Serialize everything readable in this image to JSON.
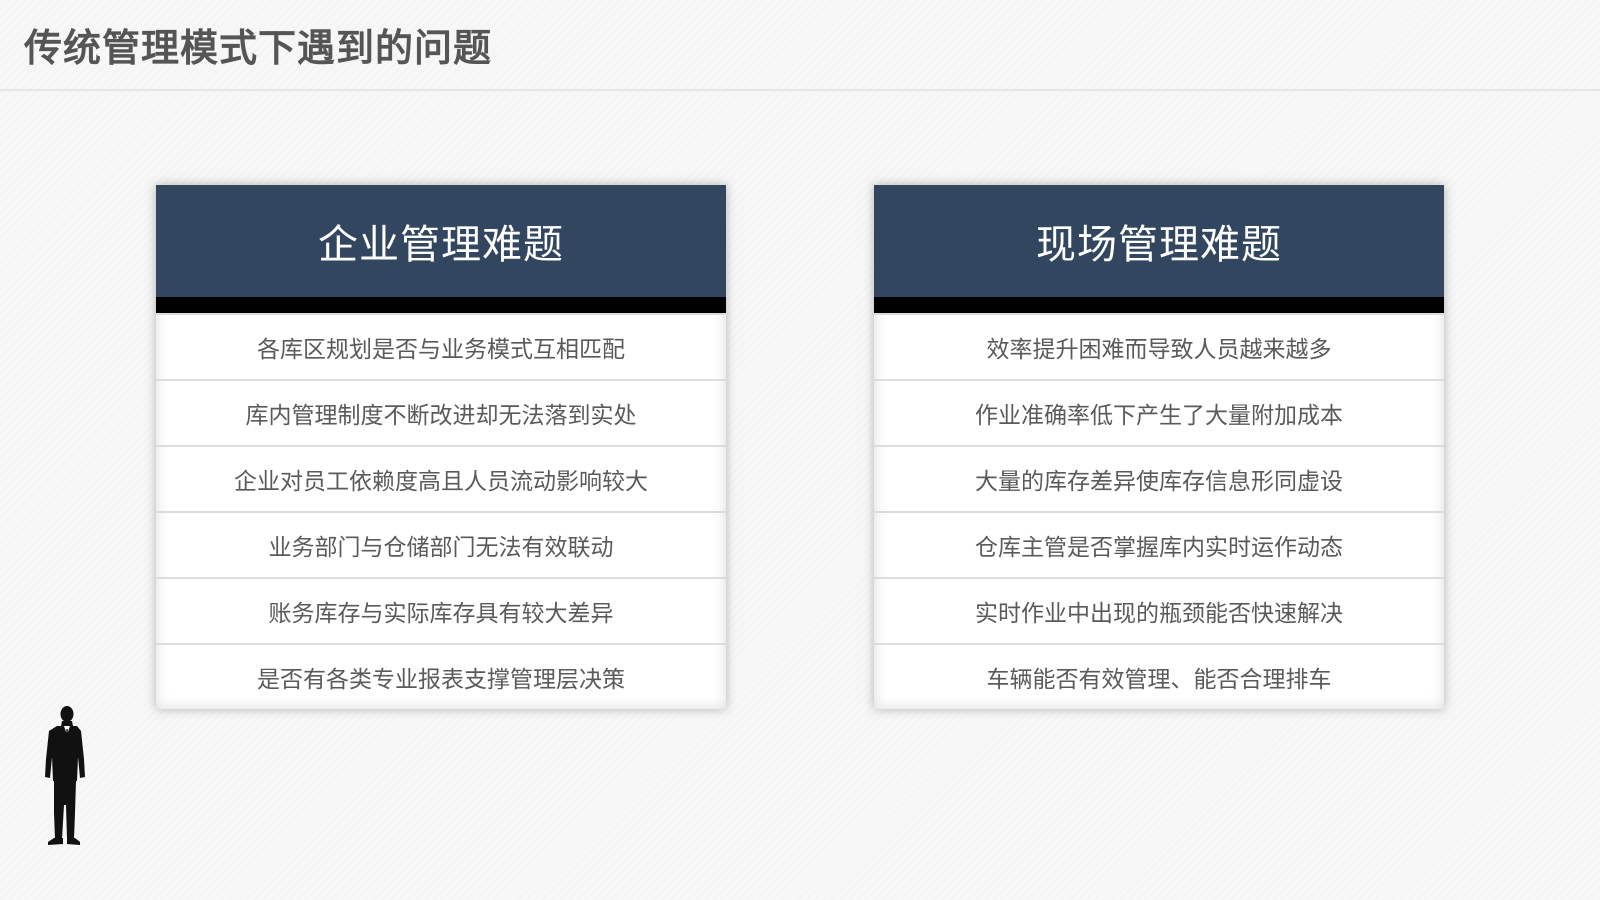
{
  "slide": {
    "title": "传统管理模式下遇到的问题"
  },
  "panels": [
    {
      "heading": "企业管理难题",
      "items": [
        "各库区规划是否与业务模式互相匹配",
        "库内管理制度不断改进却无法落到实处",
        "企业对员工依赖度高且人员流动影响较大",
        "业务部门与仓储部门无法有效联动",
        "账务库存与实际库存具有较大差异",
        "是否有各类专业报表支撑管理层决策"
      ]
    },
    {
      "heading": "现场管理难题",
      "items": [
        "效率提升困难而导致人员越来越多",
        "作业准确率低下产生了大量附加成本",
        "大量的库存差异使库存信息形同虚设",
        "仓库主管是否掌握库内实时运作动态",
        "实时作业中出现的瓶颈能否快速解决",
        "车辆能否有效管理、能否合理排车"
      ]
    }
  ],
  "colors": {
    "panel_header": "#33465f",
    "panel_bar": "#000000",
    "title_text": "#555555",
    "row_text": "#5a5a5a",
    "silhouette": "#111111"
  },
  "icons": {
    "decoration": "businessman-silhouette-icon"
  }
}
